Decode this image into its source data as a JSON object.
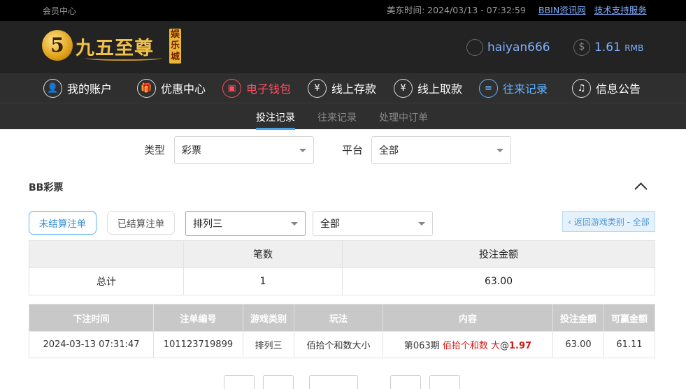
{
  "topbar": {
    "member_center": "会员中心",
    "time_label": "美东时间: 2024/03/13 - 07:32:59",
    "links": [
      "BBIN资讯网",
      "技术支持服务"
    ]
  },
  "header": {
    "logo_glyph": "5",
    "brand": "九五至尊",
    "badge": "娱乐城",
    "username": "haiyan666",
    "balance": "1.61",
    "currency": "RMB"
  },
  "nav": {
    "items": [
      {
        "label": "我的账户",
        "icon": "user-icon"
      },
      {
        "label": "优惠中心",
        "icon": "gift-icon"
      },
      {
        "label": "电子钱包",
        "icon": "wallet-icon"
      },
      {
        "label": "线上存款",
        "icon": "deposit-icon"
      },
      {
        "label": "线上取款",
        "icon": "withdraw-icon"
      },
      {
        "label": "往来记录",
        "icon": "records-icon"
      },
      {
        "label": "信息公告",
        "icon": "bell-icon"
      }
    ]
  },
  "subnav": {
    "tabs": [
      "投注记录",
      "往来记录",
      "处理中订单"
    ]
  },
  "filters": {
    "type_label": "类型",
    "type_value": "彩票",
    "platform_label": "平台",
    "platform_value": "全部"
  },
  "section": {
    "title": "BB彩票"
  },
  "toolbar": {
    "unsettled": "未结算注单",
    "settled": "已结算注单",
    "game_select": "排列三",
    "filter_select": "全部",
    "back": "‹ 返回游戏类别 - 全部"
  },
  "summary": {
    "headers": [
      "",
      "笔数",
      "投注金额"
    ],
    "row": [
      "总计",
      "1",
      "63.00"
    ]
  },
  "details": {
    "headers": [
      "下注时间",
      "注单编号",
      "游戏类别",
      "玩法",
      "内容",
      "投注金额",
      "可赢金额"
    ],
    "row": {
      "time": "2024-03-13 07:31:47",
      "id": "101123719899",
      "game": "排列三",
      "play": "佰拾个和数大小",
      "content_prefix": "第063期 ",
      "content_red": "佰拾个和数 大",
      "content_at": "@",
      "content_odds": "1.97",
      "bet": "63.00",
      "win": "61.11"
    }
  }
}
